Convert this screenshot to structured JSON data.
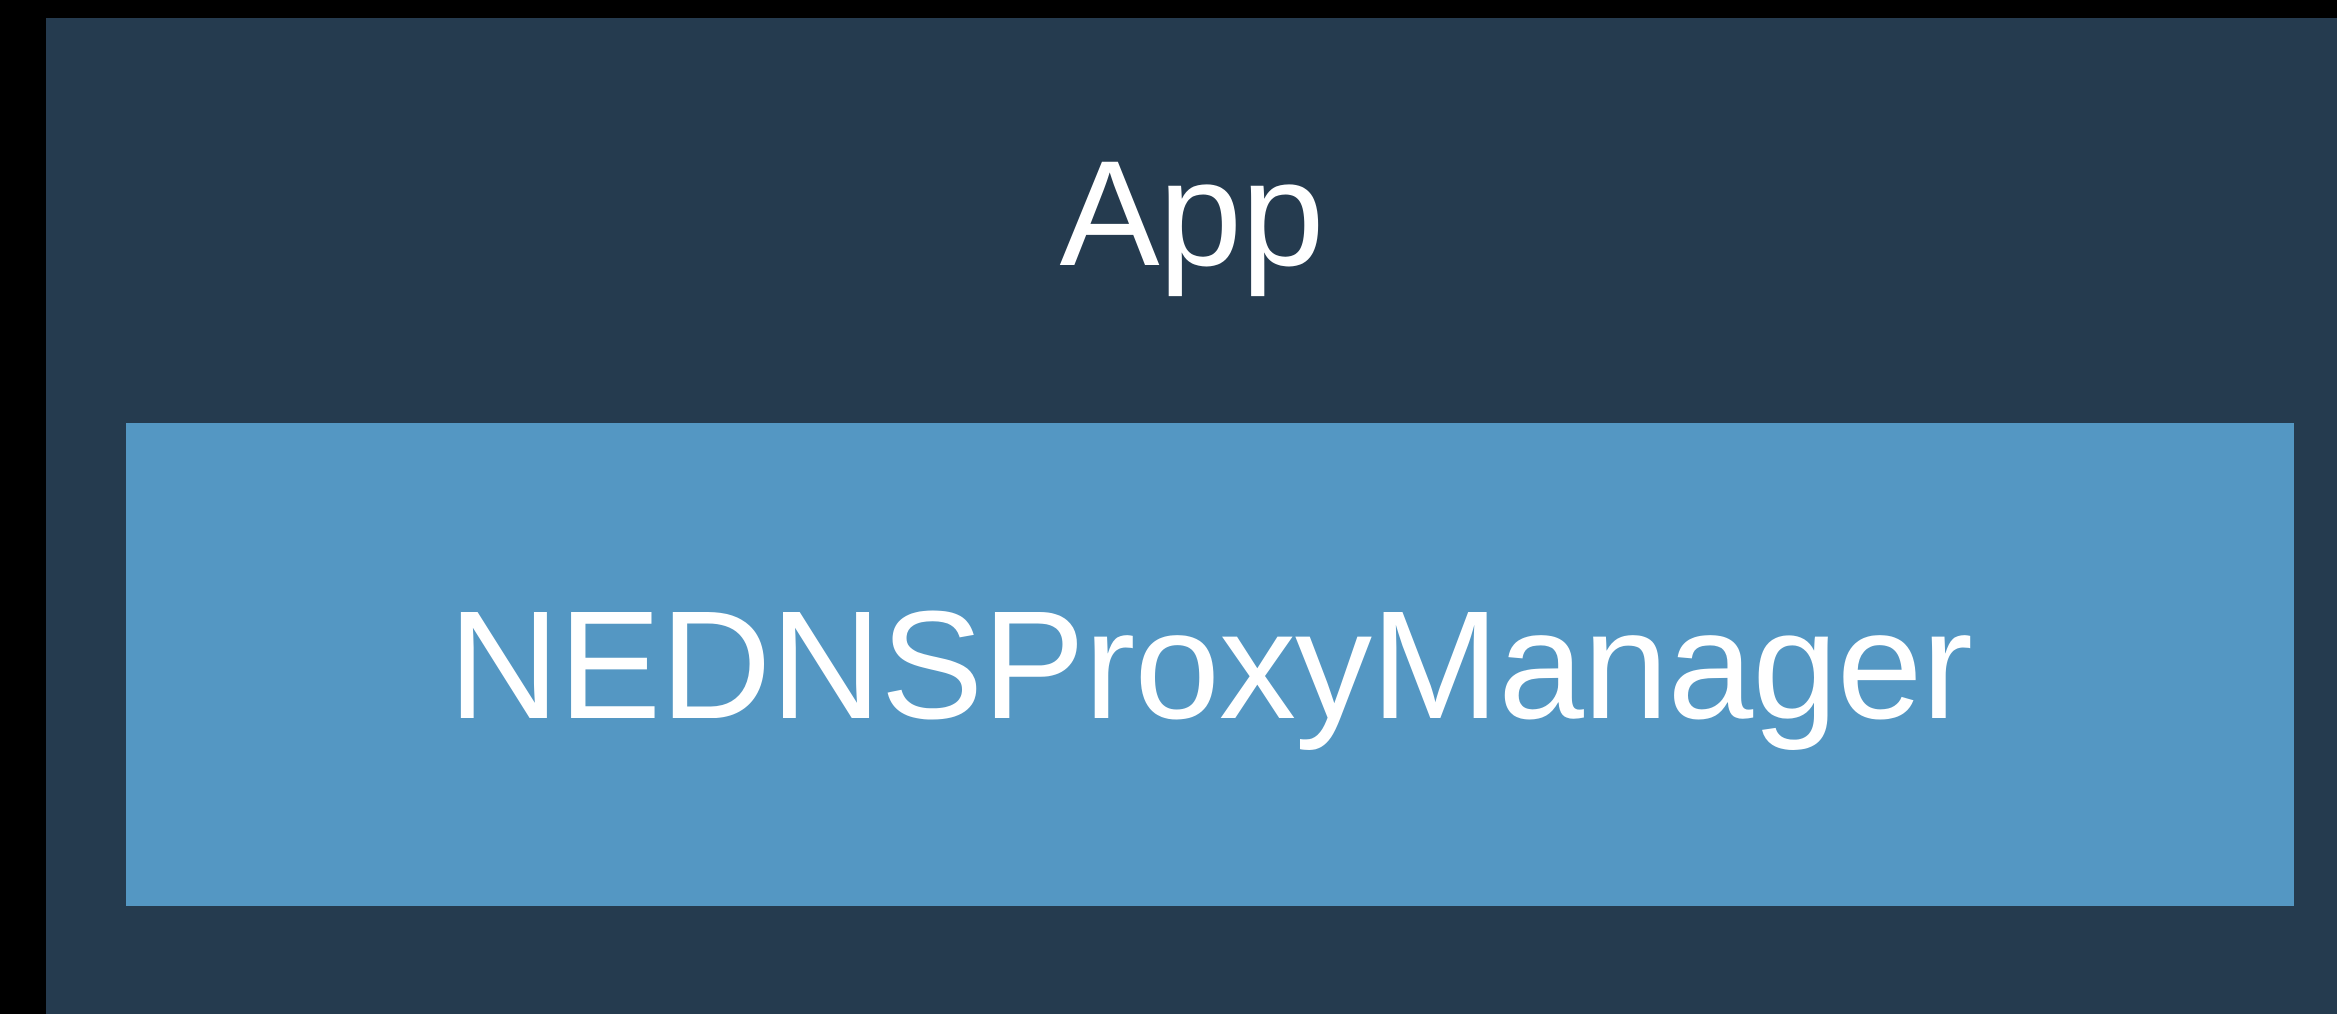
{
  "diagram": {
    "outer": {
      "label": "App",
      "color": "#253B4F"
    },
    "inner": {
      "label": "NEDNSProxyManager",
      "color": "#5497C3"
    },
    "background_color": "#000000",
    "text_color": "#FFFFFF"
  }
}
